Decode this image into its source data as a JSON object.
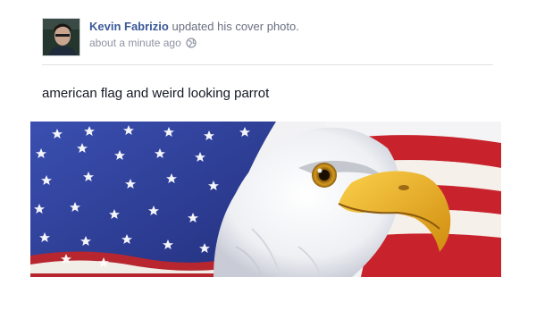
{
  "post": {
    "author_name": "Kevin Fabrizio",
    "action_text": "updated his cover photo.",
    "timestamp": "about a minute ago",
    "privacy_icon": "globe-icon",
    "message": "american flag and weird looking parrot",
    "photo_icon": "flag-and-eagle-photo"
  },
  "colors": {
    "link": "#3b5998",
    "meta_text": "#8e93a3",
    "body_text": "#141823",
    "flag_blue": "#2f3f9c",
    "flag_red": "#c8232c",
    "beak_yellow": "#f2b61d"
  }
}
